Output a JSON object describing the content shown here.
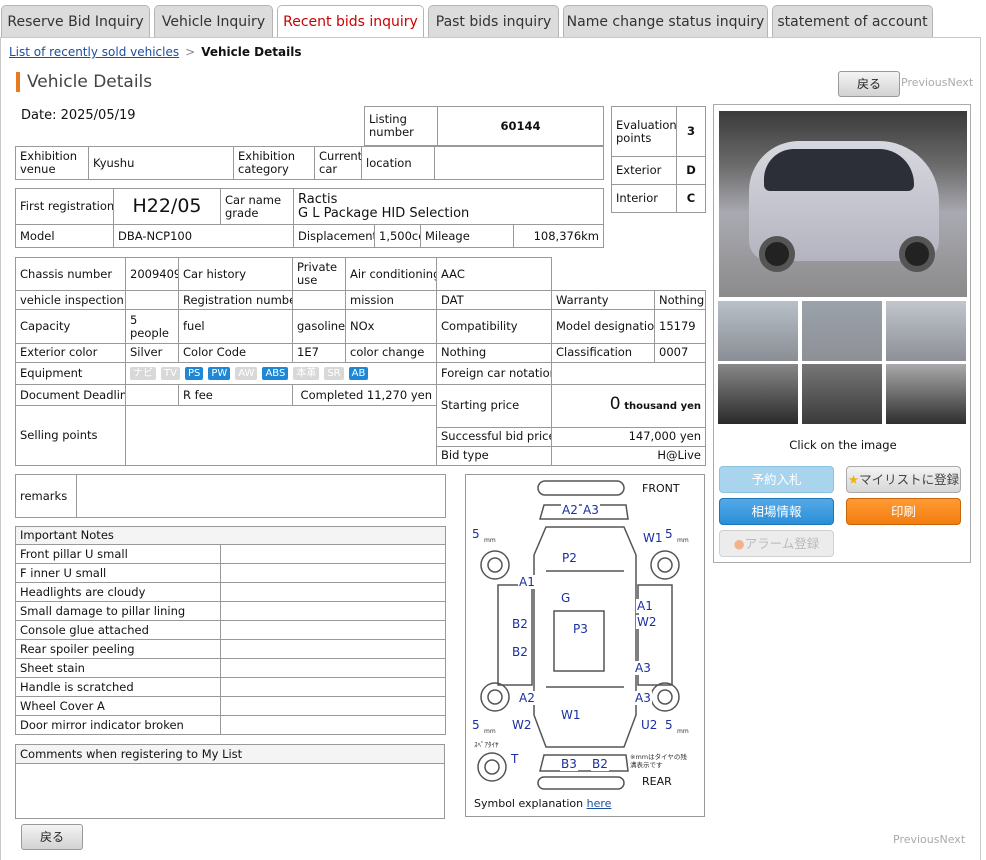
{
  "tabs": [
    {
      "label": "Reserve Bid Inquiry",
      "active": false
    },
    {
      "label": "Vehicle Inquiry",
      "active": false
    },
    {
      "label": "Recent bids inquiry",
      "active": true
    },
    {
      "label": "Past bids inquiry",
      "active": false
    },
    {
      "label": "Name change status inquiry",
      "active": false
    },
    {
      "label": "statement of account",
      "active": false
    }
  ],
  "breadcrumb": {
    "link": "List of recently sold vehicles",
    "sep": ">",
    "current": "Vehicle Details"
  },
  "page_title": "Vehicle Details",
  "nav": {
    "back": "戻る",
    "previous": "Previous",
    "next": "Next"
  },
  "header": {
    "date": "Date: 2025/05/19",
    "listing_label": "Listing number",
    "listing_number": "60144"
  },
  "venue": {
    "venue_label": "Exhibition venue",
    "venue_value": "Kyushu",
    "category_label": "Exhibition category",
    "current_car_label": "Current car",
    "location_label": "location"
  },
  "evaluation": {
    "points_label": "Evaluation points",
    "points": "3",
    "exterior_label": "Exterior",
    "exterior": "D",
    "interior_label": "Interior",
    "interior": "C"
  },
  "reg": {
    "first_reg_label": "First registration",
    "first_reg": "H22/05",
    "car_name_label": "Car name grade",
    "car_name": "Ractis",
    "grade": "G L Package HID Selection",
    "model_label": "Model",
    "model": "DBA-NCP100",
    "displacement_label": "Displacement",
    "displacement": "1,500cc",
    "mileage_label": "Mileage",
    "mileage": "108,376km"
  },
  "spec": {
    "chassis_label": "Chassis number",
    "chassis": "2009409",
    "car_history_label": "Car history",
    "private_use_label": "Private use",
    "ac_label": "Air conditioning",
    "ac": "AAC",
    "inspection_label": "vehicle inspection",
    "regnum_label": "Registration number",
    "mission_label": "mission",
    "mission": "DAT",
    "warranty_label": "Warranty",
    "warranty": "Nothing",
    "capacity_label": "Capacity",
    "capacity": "5 people",
    "fuel_label": "fuel",
    "fuel": "gasoline",
    "nox_label": "NOx",
    "compat_label": "Compatibility",
    "model_desig_label": "Model designation",
    "model_desig": "15179",
    "ext_color_label": "Exterior color",
    "ext_color": "Silver",
    "color_code_label": "Color Code",
    "color_code": "1E7",
    "color_change_label": "color change",
    "color_change": "Nothing",
    "classification_label": "Classification",
    "classification": "0007",
    "equipment_label": "Equipment",
    "foreign_label": "Foreign car notation",
    "deadline_label": "Document Deadline",
    "rfee_label": "R fee",
    "rfee": "Completed 11,270 yen",
    "starting_label": "Starting price",
    "starting_num": "0",
    "starting_unit": "thousand yen",
    "selling_label": "Selling points",
    "successful_label": "Successful bid price",
    "successful": "147,000 yen",
    "bidtype_label": "Bid type",
    "bidtype": "H@Live"
  },
  "equipment": [
    {
      "label": "ナビ",
      "on": false
    },
    {
      "label": "TV",
      "on": false
    },
    {
      "label": "PS",
      "on": true
    },
    {
      "label": "PW",
      "on": true
    },
    {
      "label": "AW",
      "on": false
    },
    {
      "label": "ABS",
      "on": true
    },
    {
      "label": "本革",
      "on": false
    },
    {
      "label": "SR",
      "on": false
    },
    {
      "label": "AB",
      "on": true
    }
  ],
  "remarks_label": "remarks",
  "notes": {
    "title": "Important Notes",
    "items": [
      "Front pillar U small",
      "F inner U small",
      "Headlights are cloudy",
      "Small damage to pillar lining",
      "Console glue attached",
      "Rear spoiler peeling",
      "Sheet stain",
      "Handle is scratched",
      "Wheel Cover A",
      "Door mirror indicator broken"
    ]
  },
  "mylist_comments_label": "Comments when registering to My List",
  "photos": {
    "click_text": "Click on the image"
  },
  "actions": {
    "reserve": "予約入札",
    "mylist": "マイリストに登録",
    "market": "相場情報",
    "print": "印刷",
    "alarm": "アラーム登録"
  },
  "diagram": {
    "front": "FRONT",
    "rear": "REAR",
    "symbol_text": "Symbol explanation",
    "symbol_link": "here",
    "spare": "ｽﾍﾟｱﾀｲﾔ",
    "mm_note": "※mmはタイヤの残溝表示です",
    "marks": [
      "A2",
      "A3",
      "W1",
      "P2",
      "A1",
      "G",
      "B2",
      "P3",
      "A1",
      "W2",
      "B2",
      "A3",
      "A2",
      "A3",
      "W2",
      "W1",
      "U2",
      "B3",
      "B2",
      "T"
    ],
    "tread": [
      "5",
      "5",
      "5",
      "5"
    ],
    "mm": "mm"
  },
  "colors": {
    "accent": "#e87a20",
    "active_tab": "#cc0000",
    "link": "#1a4fa0",
    "equip_on": "#1f88d6",
    "btn_blue": "#2a8fd8",
    "btn_orange": "#f37d10"
  }
}
